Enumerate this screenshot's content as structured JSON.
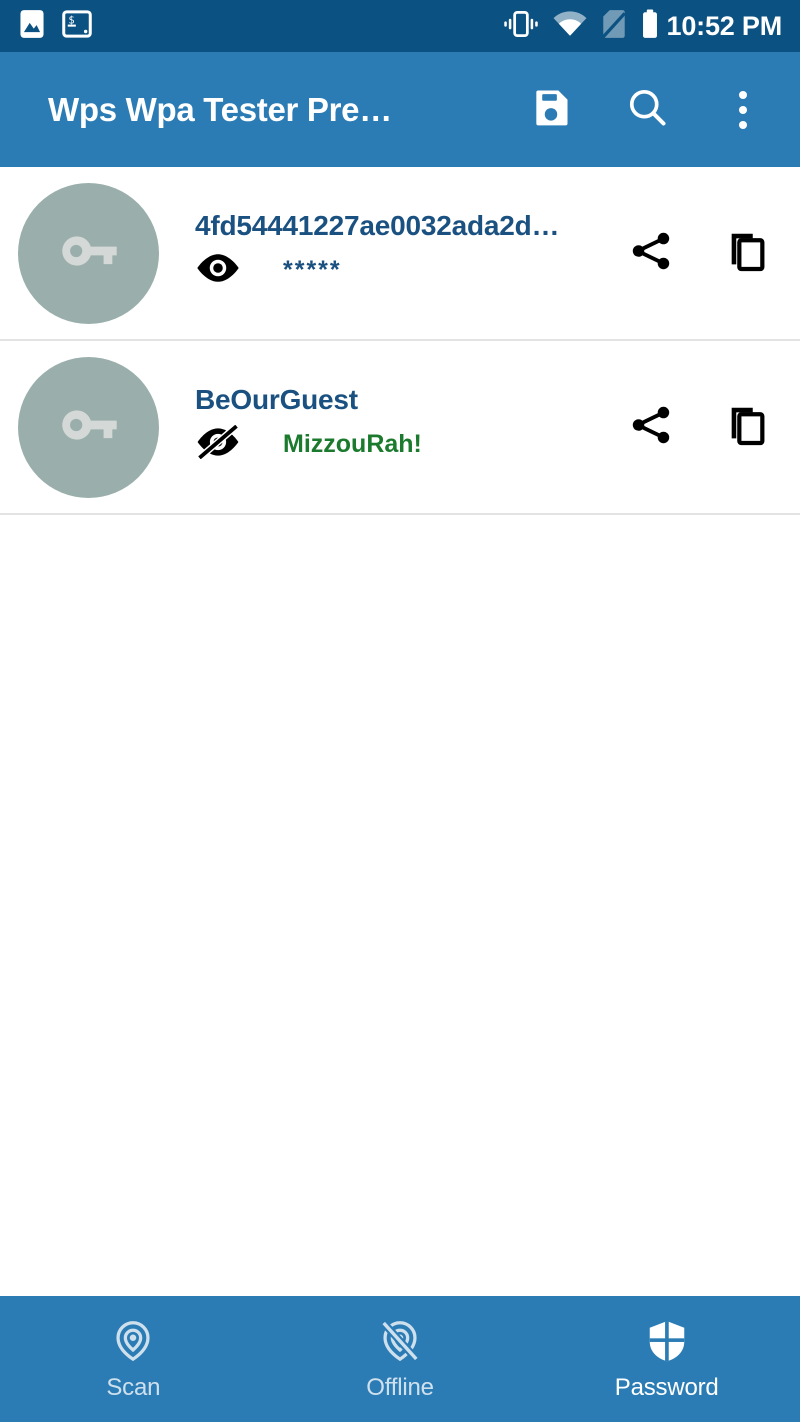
{
  "status_bar": {
    "background": "#0b5282",
    "time": "10:52 PM",
    "notification_icons": [
      "image-icon",
      "terminal-icon"
    ],
    "system_icons": [
      "vibrate-icon",
      "wifi-icon",
      "no-sim-icon",
      "battery-icon"
    ]
  },
  "app_bar": {
    "background": "#2b7cb5",
    "title": "Wps Wpa Tester Pre…",
    "actions": [
      {
        "name": "save-button",
        "icon": "save-icon"
      },
      {
        "name": "search-button",
        "icon": "search-icon"
      },
      {
        "name": "overflow-menu-button",
        "icon": "more-vertical-icon"
      }
    ]
  },
  "list": {
    "avatar_color": "#9aafab",
    "avatar_icon": "key-icon",
    "items": [
      {
        "ssid": "4fd54441227ae0032ada2d…",
        "ssid_color": "#1a5181",
        "password": "*****",
        "password_color": "#1a5181",
        "password_visible": false,
        "toggle_icon": "eye-icon",
        "share_icon": "share-icon",
        "copy_icon": "copy-icon"
      },
      {
        "ssid": "BeOurGuest",
        "ssid_color": "#1a5181",
        "password": "MizzouRah!",
        "password_color": "#1b7a2e",
        "password_visible": true,
        "toggle_icon": "eye-off-icon",
        "share_icon": "share-icon",
        "copy_icon": "copy-icon"
      }
    ]
  },
  "bottom_nav": {
    "background": "#2b7cb5",
    "active_color": "#ffffff",
    "inactive_color": "#cfe0ed",
    "items": [
      {
        "label": "Scan",
        "icon": "scan-signal-icon",
        "active": false
      },
      {
        "label": "Offline",
        "icon": "signal-off-icon",
        "active": false
      },
      {
        "label": "Password",
        "icon": "shield-icon",
        "active": true
      }
    ]
  }
}
